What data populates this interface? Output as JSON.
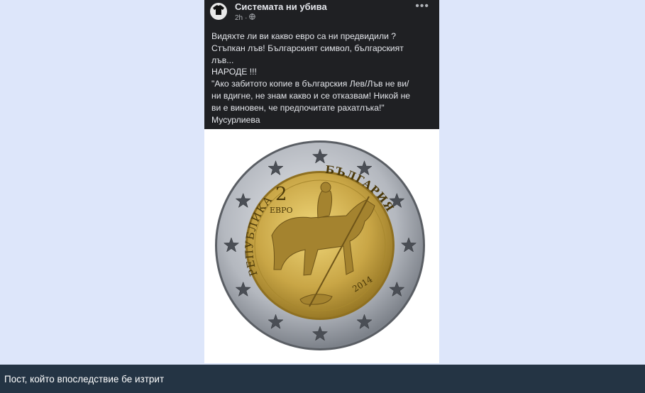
{
  "post": {
    "page_name": "Системата ни убива",
    "timestamp": "2h",
    "separator": "·",
    "audience_icon": "globe-icon",
    "more_icon": "more-options-icon",
    "more_label": "•••",
    "avatar_icon": "tshirt-icon",
    "text_lines": [
      "Видяхте ли ви какво евро са ни предвидили ?",
      "Стъпкан лъв! Българският символ, българският",
      "лъв...",
      "НАРОДЕ !!!",
      "\"Ако забитото копие в българския Лев/Лъв не ви/",
      "ни вдигне, не знам какво и се отказвам! Никой не",
      "ви е виновен, че предпочитате рахатлъка!\"",
      "Мусурлиева"
    ]
  },
  "coin": {
    "denomination": "2",
    "currency": "ЕВРО",
    "inscription_left": "РЕПУБЛИКА",
    "inscription_right": "БЪЛГАРИЯ",
    "year": "2014",
    "star_count": 12
  },
  "caption": {
    "text": "Пост, който впоследствие бе изтрит"
  },
  "colors": {
    "page_background": "#dde6fa",
    "post_dark": "#1f2023",
    "caption_bar": "#243444",
    "coin_gold": "#c9a646",
    "coin_silver": "#b8bcc2"
  }
}
